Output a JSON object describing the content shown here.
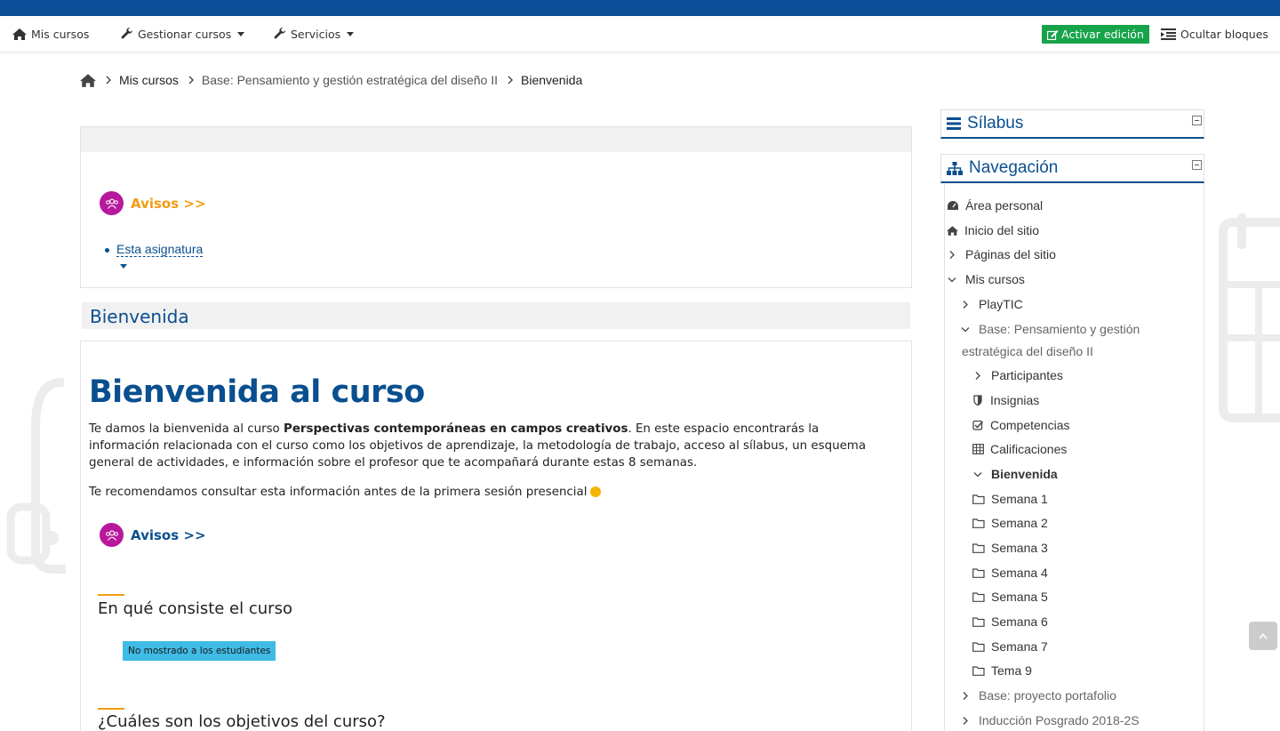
{
  "navbar": {
    "my_courses": "Mis cursos",
    "manage_courses": "Gestionar cursos",
    "services": "Servicios",
    "activate_edit": "Activar edición",
    "hide_blocks": "Ocultar bloques"
  },
  "breadcrumb": {
    "item1": "Mis cursos",
    "item2": "Base: Pensamiento y gestión estratégica del diseño II",
    "item3": "Bienvenida"
  },
  "top_box": {
    "avisos": "Avisos >>",
    "subject_link": "Esta asignatura"
  },
  "section": {
    "title": "Bienvenida",
    "heading": "Bienvenida al curso",
    "p1_before": "Te damos la bienvenida al curso ",
    "p1_bold": "Perspectivas contemporáneas en campos creativos",
    "p1_after": ". En este espacio encontrarás la información relacionada con el curso como los objetivos de aprendizaje, la metodología de trabajo, acceso al sílabus, un esquema general de actividades, e información sobre el profesor que te acompañará durante estas 8 semanas.",
    "p2": "Te recomendamos consultar esta información antes de la primera sesión presencial",
    "avisos": "Avisos >>",
    "sub1": "En qué consiste el curso",
    "badge": "No mostrado a los estudiantes",
    "sub2": "¿Cuáles son los objetivos del curso?"
  },
  "blocks": {
    "silabus": "Sílabus",
    "navegacion": "Navegación"
  },
  "nav_tree": [
    {
      "label": "Área personal",
      "icon": "dashboard-icon"
    },
    {
      "label": "Inicio del sitio",
      "icon": "home-icon"
    },
    {
      "label": "Páginas del sitio",
      "icon": "chevron-right-icon"
    },
    {
      "label": "Mis cursos",
      "icon": "chevron-down-icon"
    },
    {
      "label": "PlayTIC",
      "icon": "chevron-right-icon"
    },
    {
      "label": "Base: Pensamiento y gestión",
      "icon": "chevron-down-icon"
    },
    {
      "label": "estratégica del diseño II",
      "icon": ""
    },
    {
      "label": "Participantes",
      "icon": "chevron-right-icon"
    },
    {
      "label": "Insignias",
      "icon": "shield-icon"
    },
    {
      "label": "Competencias",
      "icon": "check-square-icon"
    },
    {
      "label": "Calificaciones",
      "icon": "table-icon"
    },
    {
      "label": "Bienvenida",
      "icon": "chevron-down-icon"
    },
    {
      "label": "Semana 1",
      "icon": "folder-icon"
    },
    {
      "label": "Semana 2",
      "icon": "folder-icon"
    },
    {
      "label": "Semana 3",
      "icon": "folder-icon"
    },
    {
      "label": "Semana 4",
      "icon": "folder-icon"
    },
    {
      "label": "Semana 5",
      "icon": "folder-icon"
    },
    {
      "label": "Semana 6",
      "icon": "folder-icon"
    },
    {
      "label": "Semana 7",
      "icon": "folder-icon"
    },
    {
      "label": "Tema 9",
      "icon": "folder-icon"
    },
    {
      "label": "Base: proyecto portafolio",
      "icon": "chevron-right-icon"
    },
    {
      "label": "Inducción Posgrado 2018-2S",
      "icon": "chevron-right-icon"
    }
  ],
  "colors": {
    "brand_blue": "#0a4f97",
    "edit_green": "#17a34a",
    "avisos_orange": "#f39c12",
    "avisos_magenta": "#b8189b",
    "badge_cyan": "#3fbbe5"
  }
}
